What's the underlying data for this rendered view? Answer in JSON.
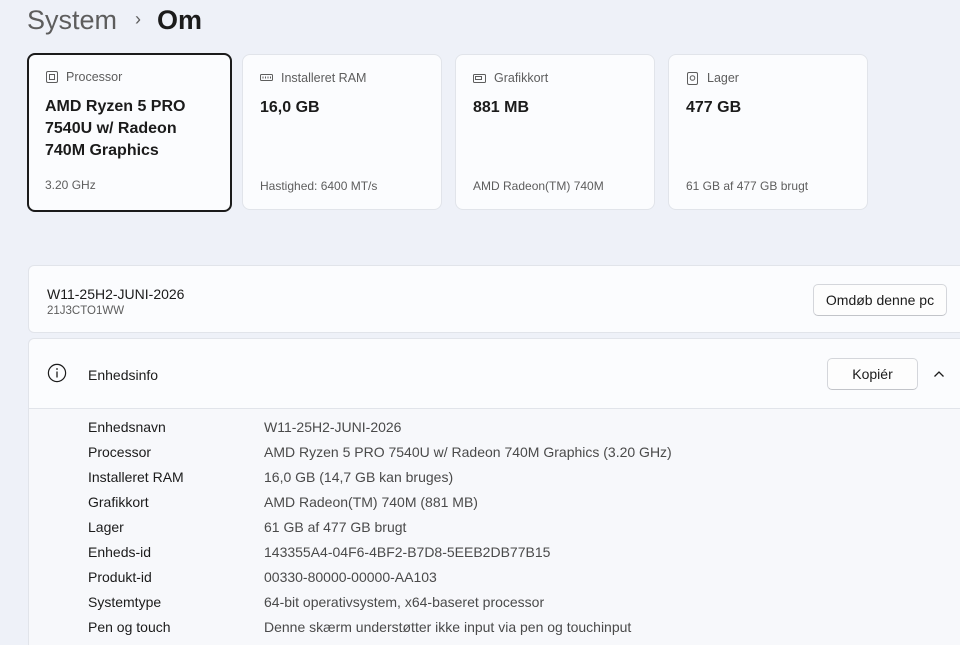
{
  "breadcrumb": {
    "parent": "System",
    "separator": "›",
    "current": "Om"
  },
  "cards": [
    {
      "icon": "processor-icon",
      "label": "Processor",
      "value": "AMD Ryzen 5 PRO 7540U w/ Radeon 740M Graphics",
      "sub": "3.20 GHz",
      "selected": true
    },
    {
      "icon": "ram-icon",
      "label": "Installeret RAM",
      "value": "16,0 GB",
      "sub": "Hastighed: 6400 MT/s"
    },
    {
      "icon": "graphics-card-icon",
      "label": "Grafikkort",
      "value": "881 MB",
      "sub": "AMD Radeon(TM) 740M"
    },
    {
      "icon": "storage-icon",
      "label": "Lager",
      "value": "477 GB",
      "sub": "61 GB af 477 GB brugt"
    }
  ],
  "device": {
    "name": "W11-25H2-JUNI-2026",
    "model": "21J3CTO1WW",
    "rename_label": "Omdøb denne pc"
  },
  "device_info": {
    "title": "Enhedsinfo",
    "icon": "info-icon",
    "copy_label": "Kopiér",
    "rows": [
      {
        "label": "Enhedsnavn",
        "value": "W11-25H2-JUNI-2026"
      },
      {
        "label": "Processor",
        "value": "AMD Ryzen 5 PRO 7540U w/ Radeon 740M Graphics (3.20 GHz)"
      },
      {
        "label": "Installeret RAM",
        "value": "16,0 GB (14,7 GB kan bruges)"
      },
      {
        "label": "Grafikkort",
        "value": "AMD Radeon(TM) 740M (881 MB)"
      },
      {
        "label": "Lager",
        "value": "61 GB af 477 GB brugt"
      },
      {
        "label": "Enheds-id",
        "value": "143355A4-04F6-4BF2-B7D8-5EEB2DB77B15"
      },
      {
        "label": "Produkt-id",
        "value": "00330-80000-00000-AA103"
      },
      {
        "label": "Systemtype",
        "value": "64-bit operativsystem, x64-baseret processor"
      },
      {
        "label": "Pen og touch",
        "value": "Denne skærm understøtter ikke input via pen og touchinput"
      }
    ]
  },
  "colors": {
    "background": "#eef1f8",
    "card": "#fbfcfe",
    "border": "#e1e4ea",
    "text_primary": "#1b1b1b",
    "text_secondary": "#5d5d5d"
  }
}
